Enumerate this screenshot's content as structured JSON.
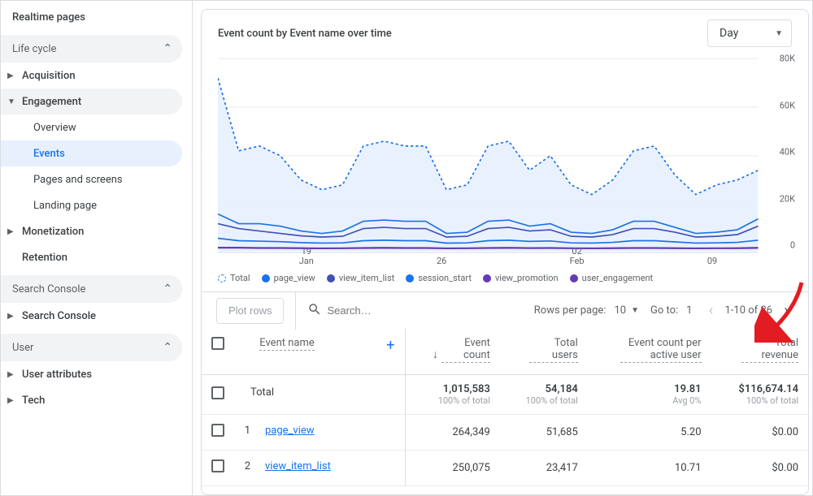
{
  "sidebar": {
    "top_item": "Realtime pages",
    "sections": [
      {
        "label": "Life cycle",
        "items": [
          {
            "label": "Acquisition",
            "caret": true
          },
          {
            "label": "Engagement",
            "caret": true,
            "highlighted": true,
            "children": [
              {
                "label": "Overview"
              },
              {
                "label": "Events",
                "selected": true
              },
              {
                "label": "Pages and screens"
              },
              {
                "label": "Landing page"
              }
            ]
          },
          {
            "label": "Monetization",
            "caret": true
          },
          {
            "label": "Retention"
          }
        ]
      },
      {
        "label": "Search Console",
        "items": [
          {
            "label": "Search Console",
            "caret": true
          }
        ]
      },
      {
        "label": "User",
        "items": [
          {
            "label": "User attributes",
            "caret": true
          },
          {
            "label": "Tech",
            "caret": true
          }
        ]
      }
    ]
  },
  "card": {
    "title": "Event count by Event name over time",
    "period": "Day"
  },
  "chart_data": {
    "type": "line",
    "x_labels": [
      {
        "pos": 0.17,
        "top": "19",
        "bottom": "Jan"
      },
      {
        "pos": 0.43,
        "top": "26",
        "bottom": ""
      },
      {
        "pos": 0.69,
        "top": "02",
        "bottom": "Feb"
      },
      {
        "pos": 0.95,
        "top": "09",
        "bottom": ""
      }
    ],
    "ylim": [
      0,
      80000
    ],
    "y_ticks": [
      0,
      20000,
      40000,
      60000,
      80000
    ],
    "y_tick_labels": [
      "0",
      "20K",
      "40K",
      "60K",
      "80K"
    ],
    "series": [
      {
        "name": "Total",
        "color": "#1a73e8",
        "dashed": true,
        "fill": "#e8f0fe",
        "values": [
          72000,
          42000,
          44000,
          40000,
          30000,
          26000,
          28000,
          44000,
          46000,
          44000,
          44000,
          26000,
          28000,
          44000,
          46000,
          34000,
          40000,
          28000,
          24000,
          30000,
          42000,
          44000,
          32000,
          24000,
          28000,
          30000,
          34000
        ]
      },
      {
        "name": "page_view",
        "color": "#1a73e8",
        "values": [
          16000,
          12000,
          12000,
          11000,
          9000,
          8000,
          9000,
          13000,
          13500,
          13000,
          13000,
          8000,
          8500,
          13000,
          13500,
          11000,
          12000,
          8500,
          8000,
          9500,
          13000,
          13000,
          10500,
          8000,
          8500,
          9500,
          14000
        ]
      },
      {
        "name": "view_item_list",
        "color": "#3f51b5",
        "values": [
          12000,
          10000,
          9000,
          8000,
          7000,
          6500,
          6800,
          10000,
          10500,
          10000,
          10000,
          6500,
          6800,
          10000,
          10500,
          9000,
          9500,
          6800,
          6500,
          7500,
          10000,
          10000,
          8500,
          6500,
          6800,
          7500,
          11000
        ]
      },
      {
        "name": "session_start",
        "color": "#1a73e8",
        "values": [
          6000,
          5000,
          4800,
          4600,
          4200,
          4000,
          4100,
          5000,
          5200,
          5000,
          5000,
          4000,
          4100,
          5000,
          5200,
          4700,
          4900,
          4100,
          4000,
          4300,
          5000,
          5000,
          4500,
          4000,
          4100,
          4300,
          5200
        ]
      },
      {
        "name": "view_promotion",
        "color": "#673ab7",
        "values": [
          2200,
          2200,
          2100,
          2100,
          2000,
          1900,
          1950,
          2100,
          2150,
          2100,
          2100,
          1900,
          1950,
          2100,
          2150,
          2050,
          2100,
          1950,
          1900,
          2000,
          2100,
          2100,
          2000,
          1900,
          1950,
          2000,
          2150
        ]
      },
      {
        "name": "user_engagement",
        "color": "#673ab7",
        "values": [
          2000,
          2000,
          1900,
          1900,
          1800,
          1750,
          1800,
          1900,
          1950,
          1900,
          1900,
          1750,
          1800,
          1900,
          1950,
          1850,
          1900,
          1800,
          1750,
          1800,
          1900,
          1900,
          1800,
          1750,
          1800,
          1800,
          1950
        ]
      }
    ]
  },
  "controls": {
    "plot_rows": "Plot rows",
    "search_placeholder": "Search…",
    "rows_per_page_label": "Rows per page:",
    "rows_per_page_value": "10",
    "goto_label": "Go to:",
    "goto_value": "1",
    "range": "1-10 of 26"
  },
  "table": {
    "columns": [
      {
        "label": "Event name"
      },
      {
        "label": "Event count",
        "sortDesc": true
      },
      {
        "label": "Total users"
      },
      {
        "label": "Event count per active user"
      },
      {
        "label": "Total revenue"
      }
    ],
    "total_row": {
      "label": "Total",
      "values": [
        "1,015,583",
        "54,184",
        "19.81",
        "$116,674.14"
      ],
      "sub": [
        "100% of total",
        "100% of total",
        "Avg 0%",
        "100% of total"
      ]
    },
    "rows": [
      {
        "n": "1",
        "name": "page_view",
        "values": [
          "264,349",
          "51,685",
          "5.20",
          "$0.00"
        ]
      },
      {
        "n": "2",
        "name": "view_item_list",
        "values": [
          "250,075",
          "23,417",
          "10.71",
          "$0.00"
        ]
      }
    ]
  }
}
